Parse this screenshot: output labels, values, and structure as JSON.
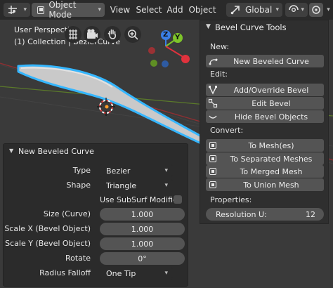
{
  "header": {
    "mode_label": "Object Mode",
    "menu": [
      "View",
      "Select",
      "Add",
      "Object"
    ],
    "orientation_label": "Global"
  },
  "viewport": {
    "view_name": "User Perspective",
    "collection_info": "(1) Collection | BezierCurve",
    "gizmo_axes": [
      "Z",
      "Y"
    ]
  },
  "panel": {
    "title": "Bevel Curve Tools",
    "sections": {
      "new": "New:",
      "edit": "Edit:",
      "convert": "Convert:",
      "properties": "Properties:"
    },
    "buttons": {
      "new_beveled_curve": "New Beveled Curve",
      "add_override_bevel": "Add/Override Bevel",
      "edit_bevel": "Edit Bevel",
      "hide_bevel_objects": "Hide Bevel Objects",
      "to_meshes": "To Mesh(es)",
      "to_separated_meshes": "To Separated Meshes",
      "to_merged_mesh": "To Merged Mesh",
      "to_union_mesh": "To Union Mesh"
    },
    "resolution": {
      "label": "Resolution U:",
      "value": "12"
    }
  },
  "operator": {
    "title": "New Beveled Curve",
    "type": {
      "label": "Type",
      "value": "Bezier"
    },
    "shape": {
      "label": "Shape",
      "value": "Triangle"
    },
    "subsurf": {
      "label": "Use SubSurf Modifier",
      "checked": false
    },
    "size": {
      "label": "Size (Curve)",
      "value": "1.000"
    },
    "scale_x": {
      "label": "Scale X (Bevel Object)",
      "value": "1.000"
    },
    "scale_y": {
      "label": "Scale Y (Bevel Object)",
      "value": "1.000"
    },
    "rotate": {
      "label": "Rotate",
      "value": "0°"
    },
    "radius_falloff": {
      "label": "Radius Falloff",
      "value": "One Tip"
    }
  },
  "colors": {
    "axis_x": "#e0323d",
    "axis_y": "#7ec42a",
    "axis_z": "#3a7fe6",
    "selection": "#35b6ff",
    "curve_fill": "#c9c9c9"
  },
  "icons": [
    "transform-pivot-icon",
    "object-mode-icon",
    "orientation-icon",
    "snap-icon",
    "proportional-icon",
    "ortho-grid-icon",
    "camera-icon",
    "hand-icon",
    "zoom-icon",
    "add-curve-icon",
    "bevel-icon",
    "edit-bevel-icon",
    "hide-icon",
    "mesh-icon"
  ]
}
